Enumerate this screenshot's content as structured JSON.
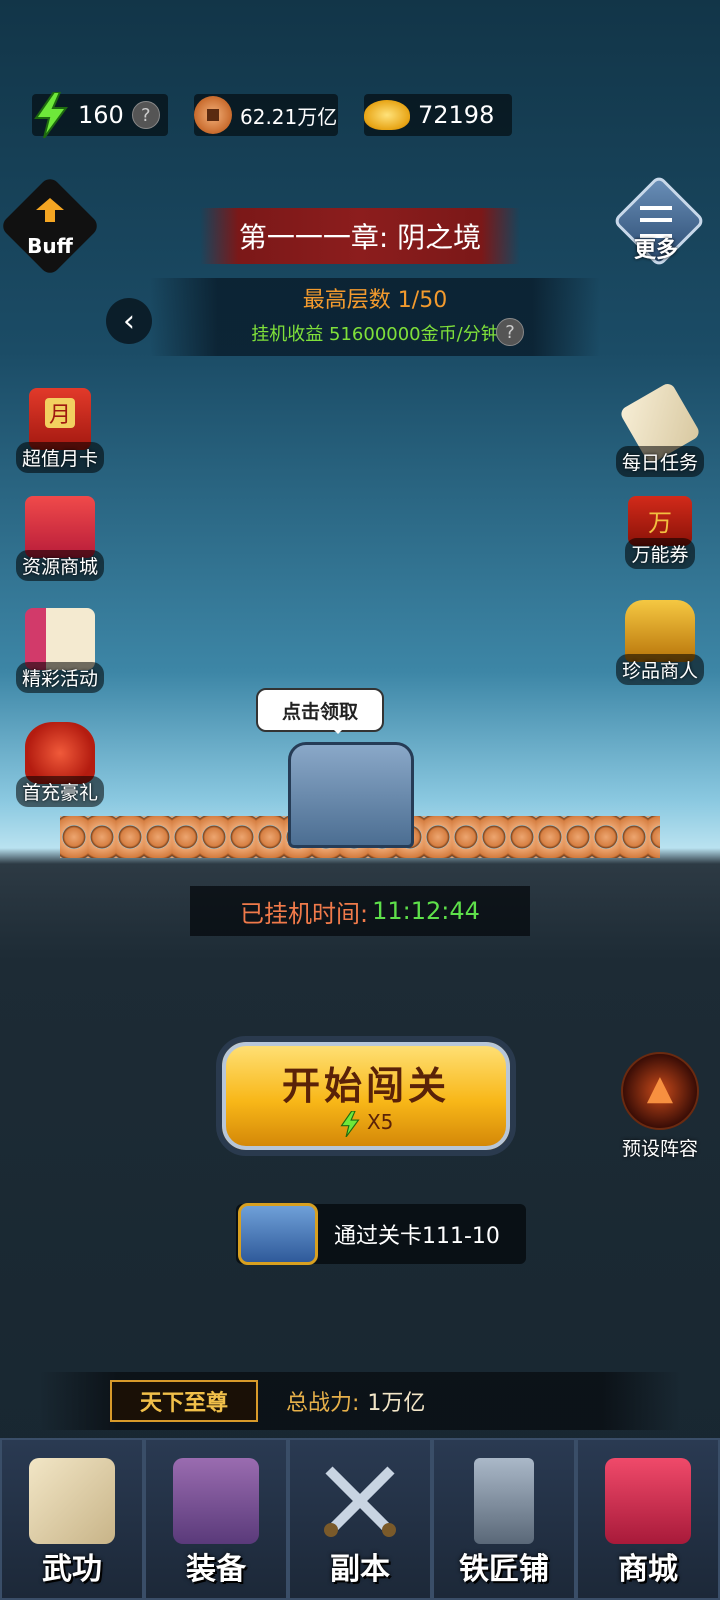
{
  "resources": {
    "energy": "160",
    "energy_help": "?",
    "copper": "62.21万亿",
    "ingot": "72198"
  },
  "top": {
    "buff_label": "Buff",
    "more_label": "更多",
    "chapter_title": "第一一一章: 阴之境",
    "max_floor": "最高层数 1/50",
    "idle_income": "挂机收益 51600000金币/分钟",
    "help": "?",
    "back": "‹"
  },
  "left_buttons": [
    {
      "label": "超值月卡",
      "badge": "月"
    },
    {
      "label": "资源商城"
    },
    {
      "label": "精彩活动"
    },
    {
      "label": "首充豪礼"
    }
  ],
  "right_buttons": [
    {
      "label": "每日任务"
    },
    {
      "label": "万能券",
      "badge": "万"
    },
    {
      "label": "珍品商人"
    }
  ],
  "scene": {
    "claim_bubble": "点击领取"
  },
  "idle_time": {
    "label": "已挂机时间:",
    "value": "11:12:44"
  },
  "start": {
    "title": "开始闯关",
    "cost": "X5"
  },
  "preset": {
    "label": "预设阵容"
  },
  "reward": {
    "text": "通过关卡111-10"
  },
  "power": {
    "rank": "天下至尊",
    "label": "总战力:",
    "value": "1万亿"
  },
  "nav": [
    {
      "label": "武功"
    },
    {
      "label": "装备"
    },
    {
      "label": "副本"
    },
    {
      "label": "铁匠铺"
    },
    {
      "label": "商城"
    }
  ],
  "colors": {
    "accent_gold": "#f8b718",
    "income_green": "#7fe03a",
    "floor_orange": "#f29a2e",
    "banner_red": "#8c1d1d"
  }
}
